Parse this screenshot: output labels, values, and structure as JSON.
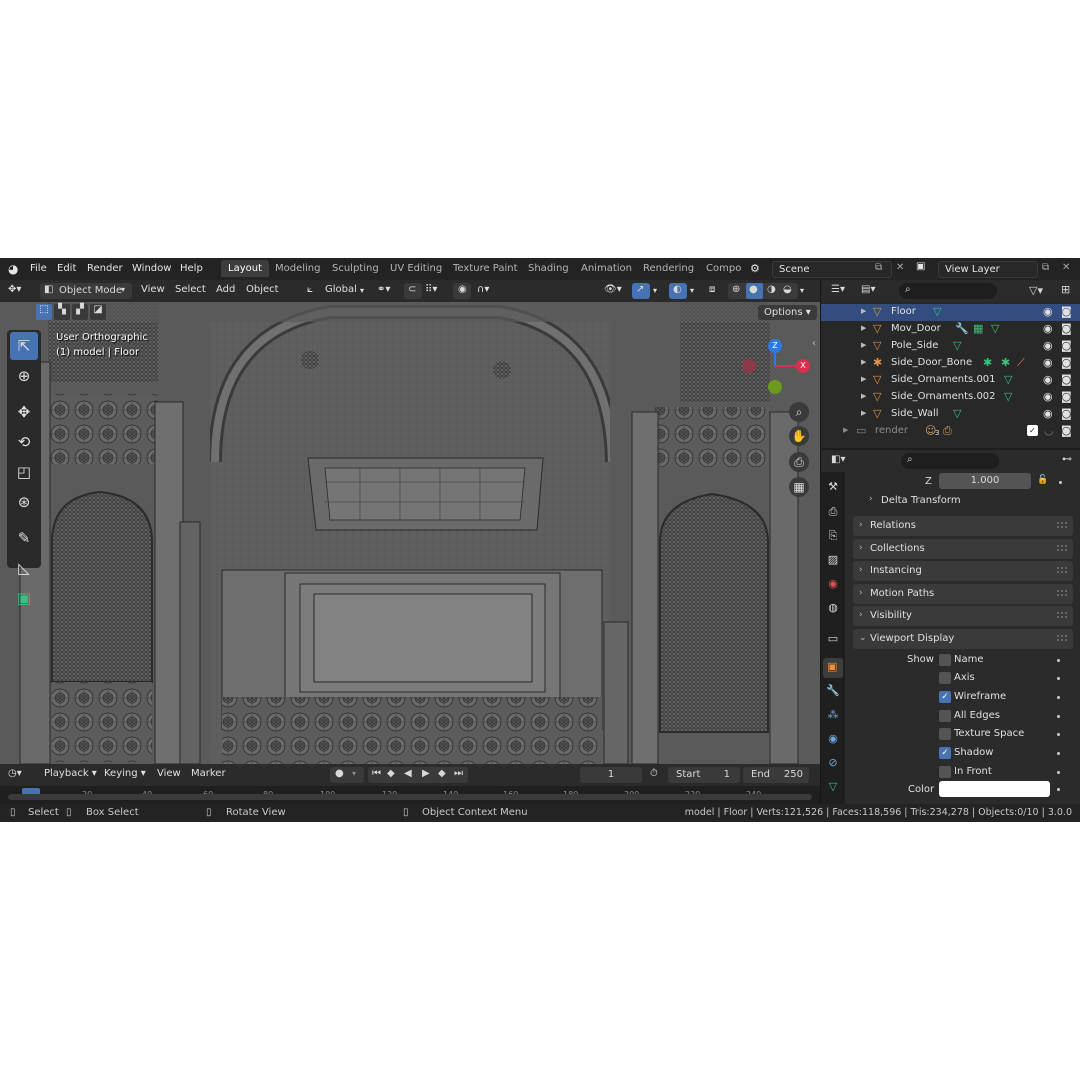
{
  "topbar": {
    "menus": [
      "File",
      "Edit",
      "Render",
      "Window",
      "Help"
    ],
    "workspaces": [
      "Layout",
      "Modeling",
      "Sculpting",
      "UV Editing",
      "Texture Paint",
      "Shading",
      "Animation",
      "Rendering",
      "Compo"
    ],
    "active_workspace": "Layout",
    "scene": "Scene",
    "view_layer": "View Layer"
  },
  "viewport_header": {
    "mode": "Object Mode",
    "menus": [
      "View",
      "Select",
      "Add",
      "Object"
    ],
    "orientation": "Global",
    "options": "Options"
  },
  "viewport": {
    "view_name": "User Orthographic",
    "object_info": "(1) model | Floor",
    "gizmo": {
      "z": "Z",
      "x": "X"
    }
  },
  "outliner": {
    "items": [
      {
        "name": "Floor"
      },
      {
        "name": "Mov_Door"
      },
      {
        "name": "Pole_Side"
      },
      {
        "name": "Side_Door_Bone"
      },
      {
        "name": "Side_Ornaments.001"
      },
      {
        "name": "Side_Ornaments.002"
      },
      {
        "name": "Side_Wall"
      }
    ],
    "collection": "render",
    "collection_count": "3"
  },
  "properties": {
    "z_label": "Z",
    "z_value": "1.000",
    "delta_transform": "Delta Transform",
    "panels": [
      "Relations",
      "Collections",
      "Instancing",
      "Motion Paths",
      "Visibility"
    ],
    "viewport_display": "Viewport Display",
    "show_label": "Show",
    "show_options": [
      {
        "label": "Name",
        "checked": false
      },
      {
        "label": "Axis",
        "checked": false
      },
      {
        "label": "Wireframe",
        "checked": true
      },
      {
        "label": "All Edges",
        "checked": false
      },
      {
        "label": "Texture Space",
        "checked": false
      },
      {
        "label": "Shadow",
        "checked": true
      },
      {
        "label": "In Front",
        "checked": false
      }
    ],
    "color_label": "Color",
    "color_value": "#ffffff"
  },
  "timeline": {
    "menus": [
      "Playback",
      "Keying",
      "View",
      "Marker"
    ],
    "current_frame": "1",
    "start_label": "Start",
    "start": "1",
    "end_label": "End",
    "end": "250",
    "ticks": [
      "20",
      "40",
      "60",
      "80",
      "100",
      "120",
      "140",
      "160",
      "180",
      "200",
      "220",
      "240"
    ]
  },
  "statusbar": {
    "select": "Select",
    "box_select": "Box Select",
    "rotate_view": "Rotate View",
    "context_menu": "Object Context Menu",
    "stats": "model | Floor | Verts:121,526 | Faces:118,596 | Tris:234,278 | Objects:0/10 | 3.0.0"
  },
  "colors": {
    "accent": "#4772b3",
    "object_orange": "#e59146",
    "mesh_green": "#37c27d",
    "gizmo_x": "#d9304f",
    "gizmo_z": "#2c7be5",
    "gizmo_y": "#6b9a1e"
  }
}
